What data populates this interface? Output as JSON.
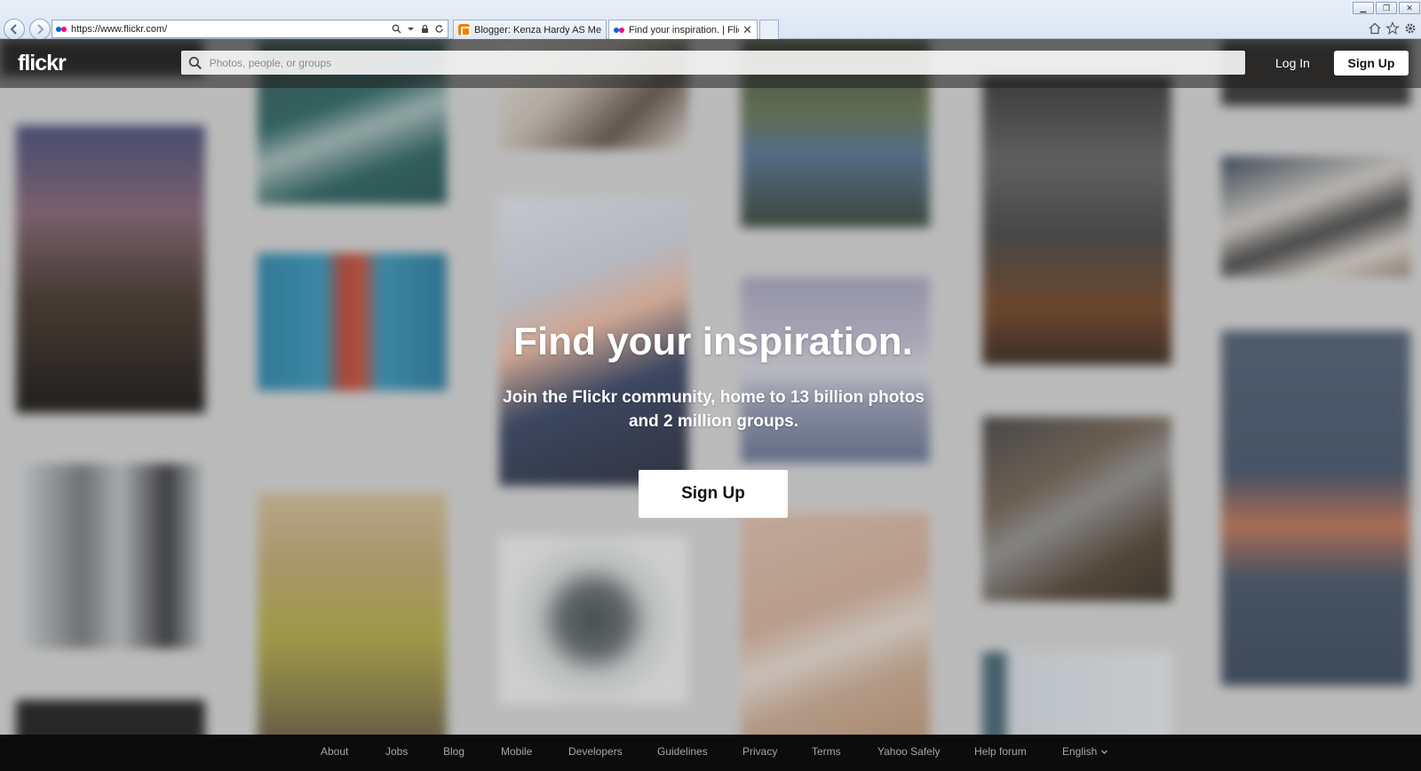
{
  "browser": {
    "url": "https://www.flickr.com/",
    "tabs": [
      {
        "label": "Blogger: Kenza Hardy AS Medi..."
      },
      {
        "label": "Find your inspiration. | Flickr"
      }
    ]
  },
  "header": {
    "logo": "flickr",
    "search_placeholder": "Photos, people, or groups",
    "login_label": "Log In",
    "signup_label": "Sign Up"
  },
  "hero": {
    "title": "Find your inspiration.",
    "subtitle_line1": "Join the Flickr community, home to 13 billion photos",
    "subtitle_line2": "and 2 million groups.",
    "cta_label": "Sign Up"
  },
  "footer": {
    "links": [
      "About",
      "Jobs",
      "Blog",
      "Mobile",
      "Developers",
      "Guidelines",
      "Privacy",
      "Terms",
      "Yahoo Safely",
      "Help forum"
    ],
    "language": "English"
  },
  "colors": {
    "brand_blue": "#0063dc",
    "brand_pink": "#ff0084",
    "footer_bg": "#0c0c0c"
  }
}
